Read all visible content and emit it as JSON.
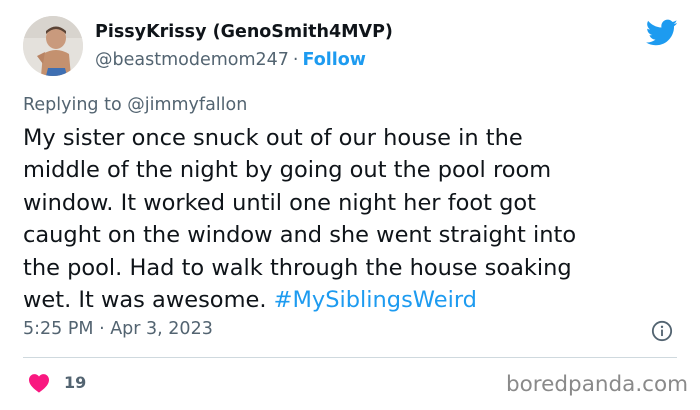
{
  "author": {
    "display_name": "PissyKrissy (GenoSmith4MVP)",
    "handle": "@beastmodemom247",
    "separator": "·",
    "follow_label": "Follow",
    "avatar_icon": "profile-photo"
  },
  "reply": {
    "prefix": "Replying to ",
    "mention": "@jimmyfallon"
  },
  "tweet": {
    "text": "My sister once snuck out of our house in the\nmiddle of the night by going out the pool room\nwindow. It worked until one night her foot got\ncaught on the window and she went straight into\nthe pool. Had to walk through the house soaking\nwet. It was awesome. ",
    "hashtag": "#MySiblingsWeird"
  },
  "meta": {
    "timestamp": "5:25 PM · Apr 3, 2023",
    "likes": "19"
  },
  "icons": {
    "brand": "twitter-bird-icon",
    "info": "info-icon",
    "like": "heart-icon"
  },
  "colors": {
    "accent": "#1d9bf0",
    "heart": "#f91880",
    "muted": "#536471",
    "text": "#0f1419"
  },
  "watermark": "boredpanda.com"
}
